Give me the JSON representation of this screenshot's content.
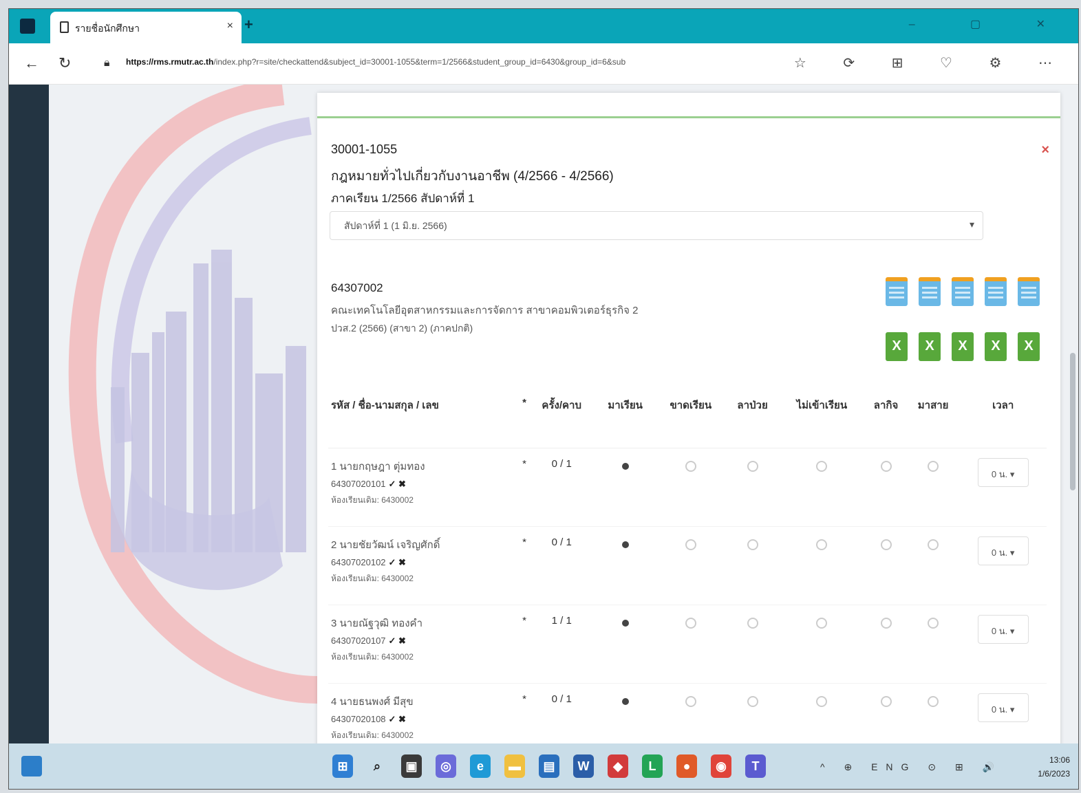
{
  "browser": {
    "tab_title": "รายชื่อนักศึกษา",
    "tab_close": "×",
    "new_tab": "+",
    "url_host": "https://rms.rmutr.ac.th",
    "url_rest": "/index.php?r=site/checkattend&subject_id=30001-1055&term=1/2566&student_group_id=6430&group_id=6&sub",
    "back_icon": "←",
    "reload_icon": "↻",
    "window_controls": "– ▢ ✕",
    "toolbar_icons": "☆ ⟳ ⊞ ♡ ⚙ ⋯"
  },
  "modal": {
    "close": "×",
    "course_code": "30001-1055",
    "course_title": "กฎหมายทั่วไปเกี่ยวกับงานอาชีพ (4/2566 - 4/2566)",
    "course_sub": "ภาคเรียน 1/2566 สัปดาห์ที่ 1",
    "week_select": "สัปดาห์ที่ 1 (1 มิ.ย. 2566)",
    "group_code": "64307002",
    "group_line1": "คณะเทคโนโลยีอุตสาหกรรมและการจัดการ สาขาคอมพิวเตอร์ธุรกิจ 2",
    "group_line2": "ปวส.2 (2566) (สาขา 2) (ภาคปกติ)"
  },
  "table": {
    "headers": [
      "รหัส / ชื่อ-นามสกุล / เลข",
      "*",
      "ครั้ง/คาบ",
      "มาเรียน",
      "ขาดเรียน",
      "ลาป่วย",
      "ไม่เข้าเรียน",
      "ลากิจ",
      "มาสาย",
      "เวลา"
    ],
    "rows": [
      {
        "name": "1 นายกฤษฎา ตุ่มทอง",
        "id": "64307020101",
        "meta": "ห้องเรียนเดิม: 6430002",
        "star": "*",
        "count": "0 / 1",
        "time": "0 น."
      },
      {
        "name": "2 นายชัยวัฒน์ เจริญศักดิ์",
        "id": "64307020102",
        "meta": "ห้องเรียนเดิม: 6430002",
        "star": "*",
        "count": "0 / 1",
        "time": "0 น."
      },
      {
        "name": "3 นายณัฐวุฒิ ทองคำ",
        "id": "64307020107",
        "meta": "ห้องเรียนเดิม: 6430002",
        "star": "*",
        "count": "1 / 1",
        "time": "0 น."
      },
      {
        "name": "4 นายธนพงศ์ มีสุข",
        "id": "64307020108",
        "meta": "ห้องเรียนเดิม: 6430002",
        "star": "*",
        "count": "0 / 1",
        "time": "0 น."
      }
    ],
    "row_mark": "✓ ✖"
  },
  "taskbar": {
    "tray": "^ ⊕ ENG ⊙ ⊞ 🔊",
    "time": "13:06",
    "date": "1/6/2023"
  },
  "colors": {
    "tab_strip": "#0aa5b8",
    "side_dark": "#233442",
    "modal_accent": "#9bd090",
    "close_red": "#d9534f"
  }
}
